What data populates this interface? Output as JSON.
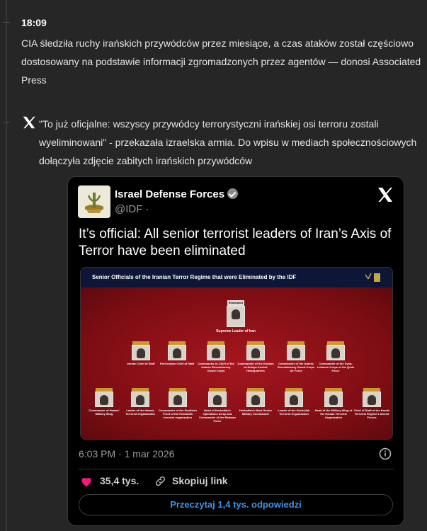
{
  "entry1": {
    "time": "18:09",
    "text": "CIA śledziła ruchy irańskich przywódców przez miesiące, a czas ataków został częściowo dostosowany na podstawie informacji zgromadzonych przez agentów — donosi Associated Press"
  },
  "entry2": {
    "icon": "x-logo-icon",
    "text": "\"To już oficjalne: wszyscy przywódcy terrorystyczni irańskiej osi terroru zostali wyeliminowani\" - przekazała izraelska armia. Do wpisu w mediach społecznościowych dołączyła zdjęcie zabitych irańskich przywódców"
  },
  "embed": {
    "account_name": "Israel Defense Forces",
    "handle": "@IDF ·",
    "text": "It’s official: All senior terrorist leaders of Iran’s Axis of Terror have been eliminated",
    "media": {
      "title": "Senior Officials of the Iranian Terror Regime that were Eliminated by the IDF",
      "top_tag": "Eliminated",
      "top_caption": "Supreme Leader of Iran",
      "row1": [
        "Iranian Chief of Staff",
        "Port Iranian Chief of Staff",
        "Commander-in-Chief of the Islamic Revolutionary Guard Corps",
        "Commander of the Khatam al-Anbiya Central Headquarters",
        "Commander of the Islamic Revolutionary Guard Corps Air Force",
        "Commander of the Syria-Lebanon Corps of the Quds Force"
      ],
      "row2": [
        "Commander of Hamas' Military Wing",
        "Leader of the Hamas Terrorist Organization",
        "Commander of the Southern Front of the Hezbollah terrorist organization",
        "Head of Hezbollah's Operations Array and Commander of the Radwan Force",
        "Hezbollah's Most Senior Military Commander",
        "Leader of the Hezbollah Terrorist Organization",
        "Head of the Military Wing of the Hamas Terrorist Organization",
        "Chief of Staff of the Houthi Terrorist Regime's Armed Forces"
      ]
    },
    "timestamp": "6:03 PM · 1 mar 2026",
    "likes": "35,4 tys.",
    "copy_link": "Skopiuj link",
    "replies_button": "Przeczytaj 1,4 tys. odpowiedzi"
  },
  "colors": {
    "background": "#262626",
    "card": "#000000",
    "like": "#f91880",
    "link_blue": "#3e95e6"
  }
}
